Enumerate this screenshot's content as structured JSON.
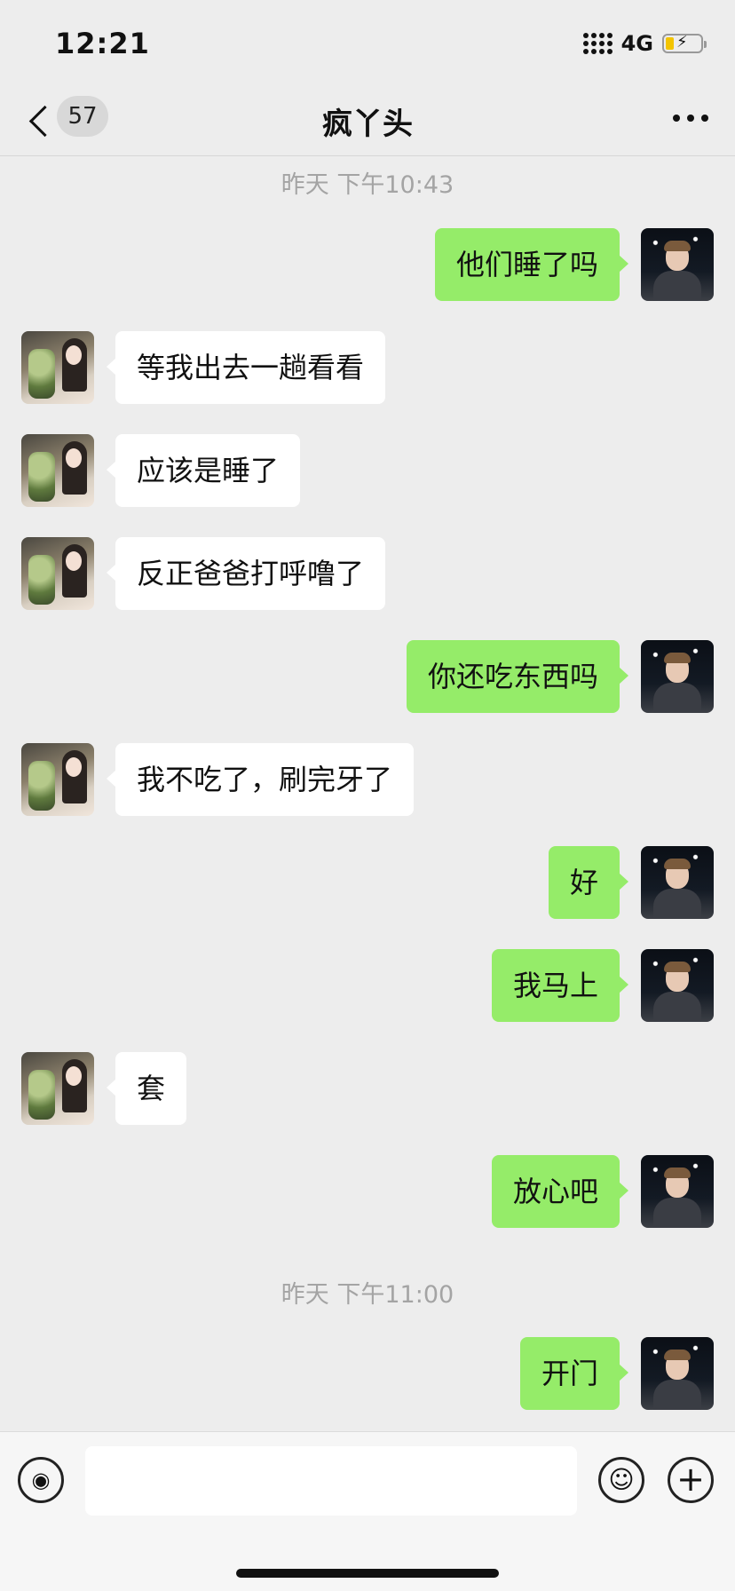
{
  "status_bar": {
    "time": "12:21",
    "network": "4G"
  },
  "nav": {
    "unread_count": "57",
    "title": "疯丫头"
  },
  "timestamps": [
    "昨天 下午10:43",
    "昨天 下午11:00"
  ],
  "messages": [
    {
      "side": "right",
      "text": "他们睡了吗"
    },
    {
      "side": "left",
      "text": "等我出去一趟看看"
    },
    {
      "side": "left",
      "text": "应该是睡了"
    },
    {
      "side": "left",
      "text": "反正爸爸打呼噜了"
    },
    {
      "side": "right",
      "text": "你还吃东西吗"
    },
    {
      "side": "left",
      "text": "我不吃了，刷完牙了"
    },
    {
      "side": "right",
      "text": "好"
    },
    {
      "side": "right",
      "text": "我马上"
    },
    {
      "side": "left",
      "text": "套"
    },
    {
      "side": "right",
      "text": "放心吧"
    },
    {
      "side": "right",
      "text": "开门"
    }
  ],
  "input_bar": {
    "voice_icon": "voice-icon",
    "emoji_icon": "emoji-icon",
    "plus_icon": "plus-icon",
    "placeholder": ""
  },
  "colors": {
    "background": "#ededed",
    "bubble_self": "#95ec69",
    "bubble_other": "#ffffff",
    "timestamp": "#a4a4a4",
    "battery": "#f3c400"
  }
}
